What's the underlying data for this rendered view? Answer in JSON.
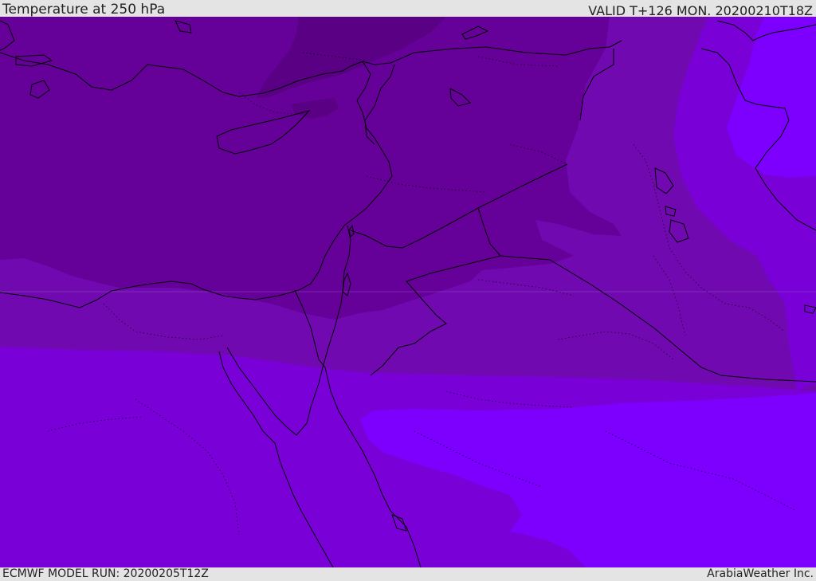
{
  "header": {
    "title": "Temperature at 250 hPa",
    "valid": "VALID T+126 MON. 20200210T18Z"
  },
  "footer": {
    "model_run": "ECMWF MODEL RUN: 20200205T12Z",
    "credit": "ArabiaWeather Inc."
  },
  "map": {
    "field": "temperature",
    "level": "250 hPa",
    "fill_colors": {
      "darkest": "#590085",
      "dark": "#650098",
      "medium": "#7009b0",
      "bright": "#7a00d8",
      "brightest": "#7d00ff"
    },
    "boundary_color": "#000000"
  }
}
